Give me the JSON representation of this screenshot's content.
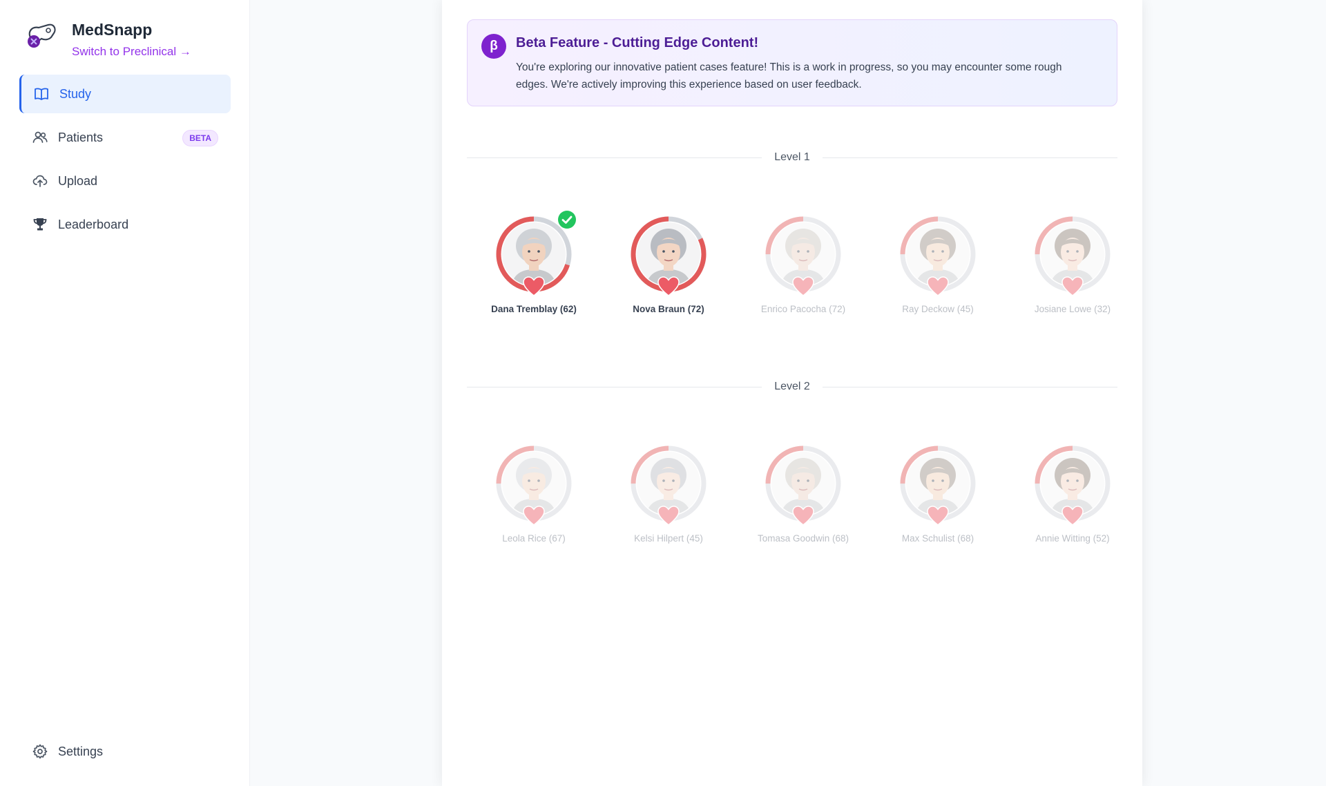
{
  "app": {
    "name": "MedSnapp",
    "switch_link": "Switch to Preclinical →"
  },
  "sidebar": {
    "items": [
      {
        "label": "Study",
        "icon": "book-icon",
        "active": true
      },
      {
        "label": "Patients",
        "icon": "users-icon",
        "badge": "BETA"
      },
      {
        "label": "Upload",
        "icon": "cloud-upload-icon"
      },
      {
        "label": "Leaderboard",
        "icon": "trophy-icon"
      }
    ],
    "settings": {
      "label": "Settings",
      "icon": "gear-icon"
    }
  },
  "banner": {
    "icon_letter": "β",
    "title": "Beta Feature - Cutting Edge Content!",
    "body": "You're exploring our innovative patient cases feature! This is a work in progress, so you may encounter some rough edges. We're actively improving this experience based on user feedback."
  },
  "levels": [
    {
      "label": "Level 1",
      "patients": [
        {
          "name": "Dana Tremblay (62)",
          "progress": 0.7,
          "unlocked": true,
          "completed": true
        },
        {
          "name": "Nova Braun (72)",
          "progress": 0.82,
          "unlocked": true,
          "completed": false
        },
        {
          "name": "Enrico Pacocha (72)",
          "progress": 0.25,
          "unlocked": false,
          "completed": false
        },
        {
          "name": "Ray Deckow (45)",
          "progress": 0.25,
          "unlocked": false,
          "completed": false
        },
        {
          "name": "Josiane Lowe (32)",
          "progress": 0.25,
          "unlocked": false,
          "completed": false
        }
      ]
    },
    {
      "label": "Level 2",
      "patients": [
        {
          "name": "Leola Rice (67)",
          "progress": 0.25,
          "unlocked": false,
          "completed": false
        },
        {
          "name": "Kelsi Hilpert (45)",
          "progress": 0.25,
          "unlocked": false,
          "completed": false
        },
        {
          "name": "Tomasa Goodwin (68)",
          "progress": 0.25,
          "unlocked": false,
          "completed": false
        },
        {
          "name": "Max Schulist (68)",
          "progress": 0.25,
          "unlocked": false,
          "completed": false
        },
        {
          "name": "Annie Witting (52)",
          "progress": 0.25,
          "unlocked": false,
          "completed": false
        }
      ]
    }
  ],
  "colors": {
    "accent_blue": "#2563eb",
    "accent_purple": "#7e22ce",
    "ring_red": "#e25a5a",
    "ring_track": "#d1d5db",
    "check_green": "#22c55e"
  }
}
